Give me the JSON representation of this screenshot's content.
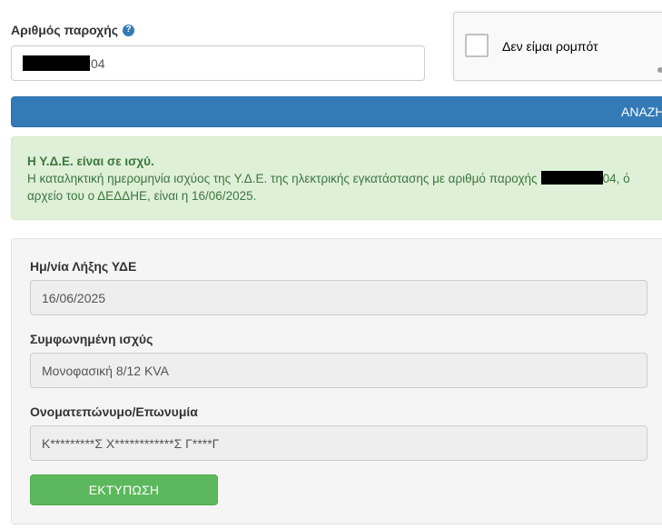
{
  "form": {
    "supply_label": "Αριθμός παροχής",
    "help_icon": "question-circle-icon",
    "supply_value_suffix": "04"
  },
  "captcha": {
    "label": "Δεν είμαι ρομπότ"
  },
  "search_button": {
    "label": "ΑΝΑΖΗ"
  },
  "alert": {
    "title": "Η Υ.Δ.Ε. είναι σε ισχύ.",
    "line1_text": "Η καταληκτική ημερομηνία ισχύος της Υ.Δ.Ε. της ηλεκτρικής εγκατάστασης με αριθμό παροχής",
    "line1_suffix": "04, ό",
    "line2": "αρχείο του ο ΔΕΔΔΗΕ, είναι η 16/06/2025."
  },
  "details": {
    "expiry": {
      "label": "Ημ/νία Λήξης ΥΔΕ",
      "value": "16/06/2025"
    },
    "power": {
      "label": "Συμφωνημένη ισχύς",
      "value": "Μονοφασική 8/12 KVA"
    },
    "name": {
      "label": "Ονοματεπώνυμο/Επωνυμία",
      "value": "Κ*********Σ Χ************Σ Γ****Γ"
    }
  },
  "print_button": {
    "label": "ΕΚΤΥΠΩΣΗ"
  },
  "colors": {
    "primary": "#337ab7",
    "success": "#5cb85c",
    "alert_bg": "#dff0d8",
    "alert_text": "#3c763d"
  }
}
